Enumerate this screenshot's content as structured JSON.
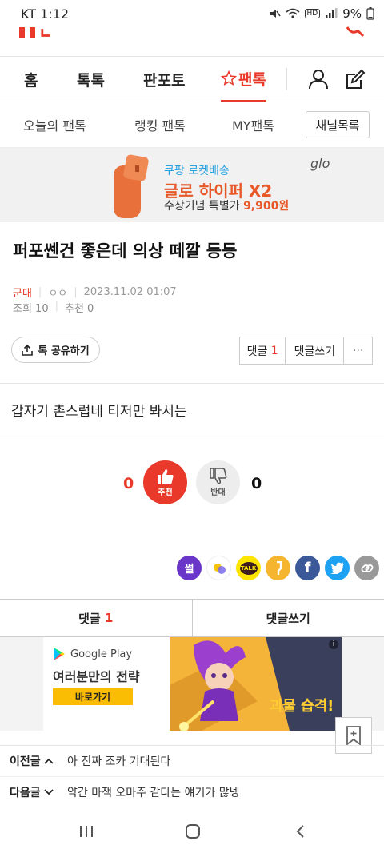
{
  "status_bar": {
    "carrier_time": "KT 1:12",
    "battery": "9%",
    "hd": "HD"
  },
  "main_nav": {
    "items": [
      "홈",
      "톡톡",
      "판포토",
      "팬톡"
    ],
    "active": "팬톡"
  },
  "sub_nav": {
    "items": [
      "오늘의 팬톡",
      "랭킹 팬톡",
      "MY팬톡"
    ],
    "channel_button": "채널목록"
  },
  "ad_banner": {
    "line1": "쿠팡 로켓배송",
    "line2": "글로 하이퍼 X2",
    "line3_prefix": "수상기념 특별가 ",
    "line3_price": "9,900원",
    "brand": "glo",
    "accent_color": "#e8592a"
  },
  "post": {
    "title": "퍼포쎈건 좋은데 의상 떼깔 등등",
    "category": "군대",
    "author": "ㅇㅇ",
    "datetime": "2023.11.02 01:07",
    "views": "조회 10",
    "recommends": "추천 0",
    "body": "갑자기 촌스럽네 티저만 봐서는"
  },
  "actions": {
    "share_label": "톡 공유하기",
    "comment_label": "댓글",
    "comment_count": "1",
    "write_comment_label": "댓글쓰기",
    "more_label": "···"
  },
  "vote": {
    "up_count": "0",
    "up_label": "추천",
    "down_label": "반대",
    "down_count": "0"
  },
  "share_icons": [
    {
      "name": "ssul-icon",
      "label": "썰",
      "color": "#6a35c9"
    },
    {
      "name": "band-icon",
      "label": "",
      "color": "#ffffff"
    },
    {
      "name": "kakaotalk-icon",
      "label": "TALK",
      "color": "#fee500"
    },
    {
      "name": "kakaostory-icon",
      "label": "",
      "color": "#f5b52e"
    },
    {
      "name": "facebook-icon",
      "label": "f",
      "color": "#3b5998"
    },
    {
      "name": "twitter-icon",
      "label": "",
      "color": "#1da1f2"
    },
    {
      "name": "link-icon",
      "label": "",
      "color": "#999999"
    }
  ],
  "bottom_tabs": {
    "comment_label": "댓글",
    "comment_count": "1",
    "write_label": "댓글쓰기"
  },
  "google_ad": {
    "brand": "Google Play",
    "headline": "여러분만의 전략",
    "cta": "바로가기",
    "art_text": "괴물 습격!",
    "info": "i"
  },
  "post_nav": {
    "prev_label": "이전글",
    "prev_title": "아 진짜 조카 기대된다",
    "next_label": "다음글",
    "next_title": "약간 마잭 오마주 같다는 얘기가 많넹"
  }
}
